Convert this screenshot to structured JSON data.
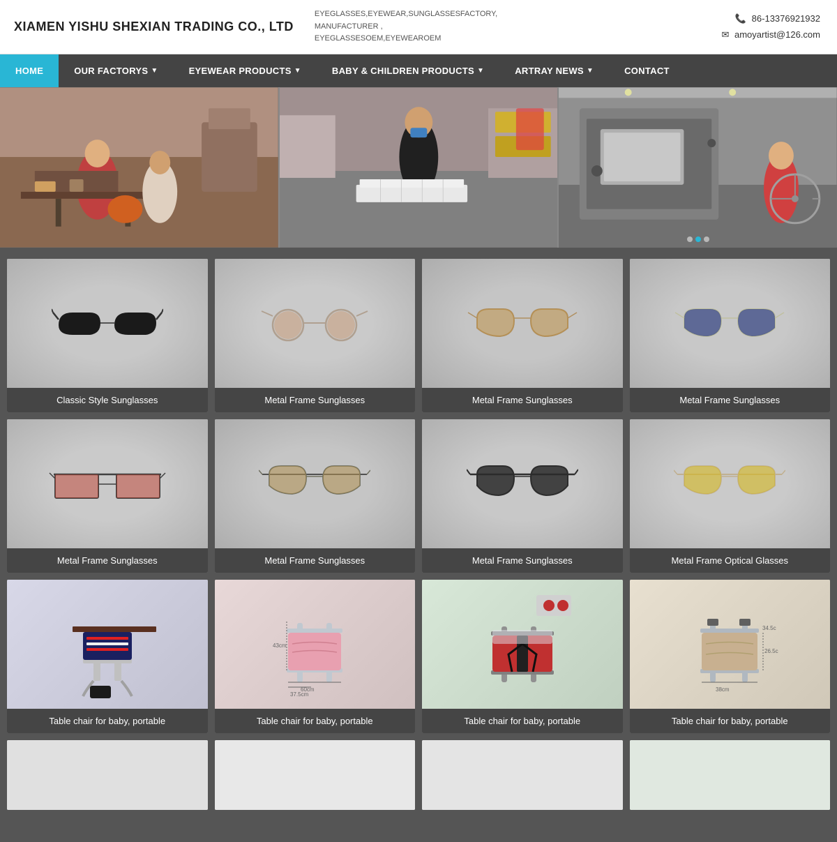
{
  "header": {
    "company_name": "XIAMEN YISHU SHEXIAN TRADING CO., LTD",
    "tagline_line1": "EYEGLASSES,EYEWEAR,SUNGLASSESFACTORY,",
    "tagline_line2": "MANUFACTURER , EYEGLASSESOEM,EYEWEAROEM",
    "phone": "86-13376921932",
    "email": "amoyartist@126.com",
    "phone_icon": "📞",
    "email_icon": "✉"
  },
  "nav": {
    "items": [
      {
        "label": "HOME",
        "active": true,
        "has_arrow": false
      },
      {
        "label": "OUR FACTORYS",
        "active": false,
        "has_arrow": true
      },
      {
        "label": "EYEWEAR PRODUCTS",
        "active": false,
        "has_arrow": true
      },
      {
        "label": "BABY & CHILDREN PRODUCTS",
        "active": false,
        "has_arrow": true
      },
      {
        "label": "ARTRAY NEWS",
        "active": false,
        "has_arrow": true
      },
      {
        "label": "CONTACT",
        "active": false,
        "has_arrow": false
      }
    ]
  },
  "hero": {
    "panels": [
      {
        "alt": "Factory worker assembling eyewear"
      },
      {
        "alt": "Factory worker sorting eyewear"
      },
      {
        "alt": "Factory machinery"
      }
    ],
    "active_dot": 1
  },
  "products": {
    "row1": [
      {
        "label": "Classic Style Sunglasses",
        "type": "classic"
      },
      {
        "label": "Metal Frame Sunglasses",
        "type": "metal_round"
      },
      {
        "label": "Metal Frame Sunglasses",
        "type": "metal_aviator_brown"
      },
      {
        "label": "Metal Frame Sunglasses",
        "type": "metal_aviator_blue"
      }
    ],
    "row2": [
      {
        "label": "Metal Frame Sunglasses",
        "type": "metal_square_red"
      },
      {
        "label": "Metal Frame Sunglasses",
        "type": "metal_aviator_brown2"
      },
      {
        "label": "Metal Frame Sunglasses",
        "type": "metal_aviator_dark"
      },
      {
        "label": "Metal Frame Optical Glasses",
        "type": "metal_optical_yellow"
      }
    ],
    "row3": [
      {
        "label": "Table chair for baby, portable",
        "type": "baby1"
      },
      {
        "label": "Table chair for baby, portable",
        "type": "baby2"
      },
      {
        "label": "Table chair for baby, portable",
        "type": "baby3"
      },
      {
        "label": "Table chair for baby, portable",
        "type": "baby4"
      }
    ]
  }
}
